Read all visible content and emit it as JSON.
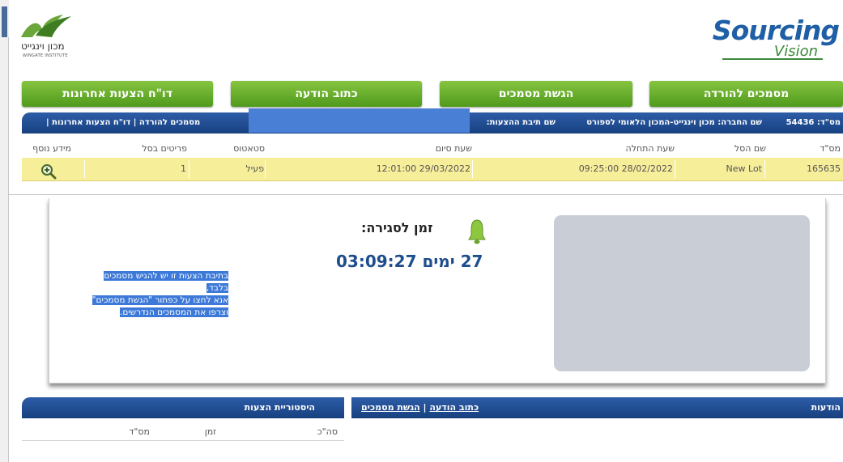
{
  "logos": {
    "left_heb": "מכון וינגייט",
    "left_eng": "WINGATE INSTITUTE",
    "right_big": "Sourcing",
    "right_small": "Vision"
  },
  "nav_buttons": {
    "report": "דו\"ח הצעות אחרונות",
    "write_message": "כתוב הודעה",
    "submit_docs": "הגשת מסמכים",
    "docs_download": "מסמכים להורדה"
  },
  "header_bar": {
    "tender_id": "מס\"ד: 54436",
    "company": "שם החברה: מכון וינגייט-המכון הלאומי לספורט",
    "box_name": "שם תיבת ההצעות:",
    "links": "מסמכים להורדה  |  דו\"ח הצעות אחרונות  |"
  },
  "table": {
    "headers": [
      "מס\"ד",
      "שם הסל",
      "שעת התחלה",
      "שעת סיום",
      "סטאטוס",
      "פריטים בסל",
      "מידע נוסף"
    ],
    "row": [
      "165635",
      "New Lot",
      "09:25:00 28/02/2022",
      "12:01:00 29/03/2022",
      "פעיל",
      "1",
      ""
    ]
  },
  "closing": {
    "label": "זמן לסגירה:",
    "countdown": "27 ימים 03:09:27"
  },
  "note_lines": [
    "בתיבת הצעות זו יש להגיש מסמכים בלבד,",
    "אנא לחצו על כפתור \"הגשת מסמכים\"",
    "וצרפו את המסמכים הנדרשים."
  ],
  "bottom": {
    "messages_title": "הודעות",
    "write_message_link": "כתוב הודעה",
    "separator": "|",
    "submit_docs_link": "הגשת מסמכים",
    "history_title": "היסטוריית הצעות",
    "history_headers": [
      "מס\"ד",
      "זמן",
      "סה\"כ"
    ]
  },
  "colors": {
    "green": "#5fa82a",
    "blue": "#1f4e8c",
    "row_yellow": "#f7ee9a"
  }
}
